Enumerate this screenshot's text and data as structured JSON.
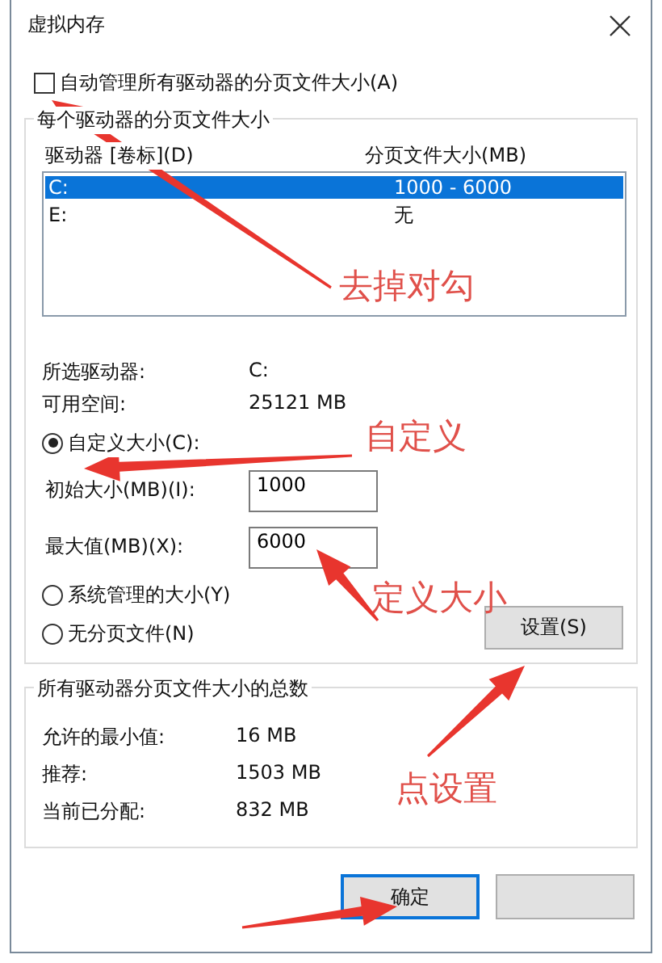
{
  "window": {
    "title": "虚拟内存"
  },
  "auto_manage": {
    "label": "自动管理所有驱动器的分页文件大小(A)",
    "checked": false
  },
  "drives_group": {
    "title": "每个驱动器的分页文件大小",
    "columns": [
      "驱动器 [卷标](D)",
      "分页文件大小(MB)"
    ],
    "rows": [
      {
        "drive": "C:",
        "size": "1000 - 6000",
        "selected": true
      },
      {
        "drive": "E:",
        "size": "无",
        "selected": false
      }
    ],
    "info": [
      {
        "label": "所选驱动器:",
        "value": "C:"
      },
      {
        "label": "可用空间:",
        "value": "25121 MB"
      }
    ],
    "size_options": [
      {
        "label": "自定义大小(C):",
        "selected": true
      },
      {
        "label": "系统管理的大小(Y)",
        "selected": false
      },
      {
        "label": "无分页文件(N)",
        "selected": false
      }
    ],
    "fields": [
      {
        "label": "初始大小(MB)(I):",
        "value": "1000"
      },
      {
        "label": "最大值(MB)(X):",
        "value": "6000"
      }
    ],
    "set_button": "设置(S)"
  },
  "totals_group": {
    "title": "所有驱动器分页文件大小的总数",
    "rows": [
      {
        "label": "允许的最小值:",
        "value": "16 MB"
      },
      {
        "label": "推荐:",
        "value": "1503 MB"
      },
      {
        "label": "当前已分配:",
        "value": "832 MB"
      }
    ]
  },
  "buttons": [
    {
      "label": "确定",
      "default": true
    },
    {
      "default": false
    }
  ],
  "annotations": [
    "去掉对勾",
    "自定义",
    "定义大小",
    "点设置"
  ]
}
